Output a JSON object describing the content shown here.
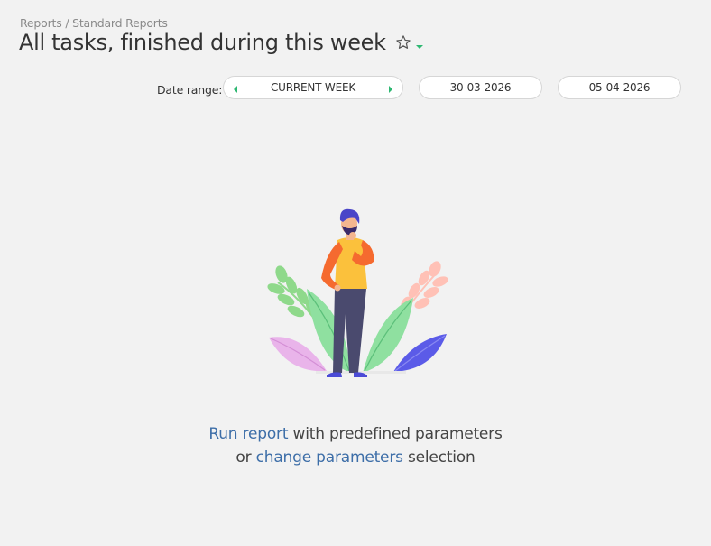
{
  "breadcrumb": {
    "parent": "Reports",
    "separator": " / ",
    "current": "Standard Reports"
  },
  "page": {
    "title": "All tasks, finished during this week"
  },
  "date_range": {
    "label": "Date range:",
    "preset": "CURRENT WEEK",
    "from": "30-03-2026",
    "to": "05-04-2026"
  },
  "empty_state": {
    "run_link": "Run report",
    "line1_rest": " with predefined parameters",
    "line2_prefix": "or ",
    "change_link": "change parameters",
    "line2_rest": " selection"
  },
  "icons": {
    "favorite": "star-outline-icon",
    "menu": "caret-down-icon",
    "prev": "arrow-left-icon",
    "next": "arrow-right-icon",
    "illustration": "thinking-person-illustration"
  },
  "colors": {
    "background": "#f2f2f2",
    "accent_green": "#2eb872",
    "link_blue": "#3d6ea8",
    "text": "#333333",
    "muted": "#8a8a8a"
  }
}
